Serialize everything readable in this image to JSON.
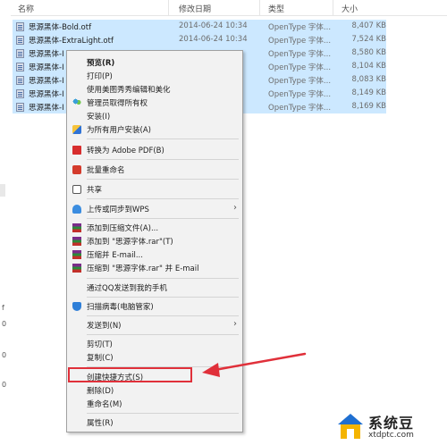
{
  "columns": {
    "name": "名称",
    "date": "修改日期",
    "type": "类型",
    "size": "大小"
  },
  "files": [
    {
      "name": "思源黑体-Bold.otf",
      "date": "2014-06-24 10:34",
      "type": "OpenType 字体...",
      "size": "8,407 KB"
    },
    {
      "name": "思源黑体-ExtraLight.otf",
      "date": "2014-06-24 10:34",
      "type": "OpenType 字体...",
      "size": "7,524 KB"
    },
    {
      "name": "思源黑体-I",
      "date": "",
      "type": "OpenType 字体...",
      "size": "8,580 KB"
    },
    {
      "name": "思源黑体-I",
      "date": "",
      "type": "OpenType 字体...",
      "size": "8,104 KB"
    },
    {
      "name": "思源黑体-I",
      "date": "",
      "type": "OpenType 字体...",
      "size": "8,083 KB"
    },
    {
      "name": "思源黑体-I",
      "date": "",
      "type": "OpenType 字体...",
      "size": "8,149 KB"
    },
    {
      "name": "思源黑体-I",
      "date": "",
      "type": "OpenType 字体...",
      "size": "8,169 KB"
    }
  ],
  "context_menu": {
    "items": [
      {
        "label": "预览(R)",
        "icon": ""
      },
      {
        "label": "打印(P)",
        "icon": ""
      },
      {
        "label": "使用美图秀秀编辑和美化",
        "icon": ""
      },
      {
        "label": "管理员取得所有权",
        "icon": "people-icon"
      },
      {
        "label": "安装(I)",
        "icon": ""
      },
      {
        "label": "为所有用户安装(A)",
        "icon": "uac-shield-icon"
      },
      {
        "label": "转换为 Adobe PDF(B)",
        "icon": "pdf-icon"
      },
      {
        "label": "批量重命名",
        "icon": "wps-icon"
      },
      {
        "label": "共享",
        "icon": "share-icon"
      },
      {
        "label": "上传或同步到WPS",
        "icon": "cloud-icon",
        "submenu": true
      },
      {
        "label": "添加到压缩文件(A)...",
        "icon": "winrar-icon"
      },
      {
        "label": "添加到 \"思源字体.rar\"(T)",
        "icon": "winrar-icon"
      },
      {
        "label": "压缩并 E-mail...",
        "icon": "winrar-icon"
      },
      {
        "label": "压缩到 \"思源字体.rar\" 并 E-mail",
        "icon": "winrar-icon"
      },
      {
        "label": "通过QQ发送到我的手机",
        "icon": ""
      },
      {
        "label": "扫描病毒(电脑管家)",
        "icon": "shield-icon"
      },
      {
        "label": "发送到(N)",
        "icon": "",
        "submenu": true
      },
      {
        "label": "剪切(T)",
        "icon": ""
      },
      {
        "label": "复制(C)",
        "icon": ""
      },
      {
        "label": "创建快捷方式(S)",
        "icon": ""
      },
      {
        "label": "删除(D)",
        "icon": ""
      },
      {
        "label": "重命名(M)",
        "icon": ""
      },
      {
        "label": "属性(R)",
        "icon": ""
      }
    ],
    "submenu_arrow": "›"
  },
  "left_strip_marks": [
    "f",
    "0",
    "0",
    "0"
  ],
  "watermark": {
    "brand": "系统豆",
    "domain": "xtdptc.com"
  },
  "colors": {
    "row_selected": "#cce8ff",
    "menu_bg": "#f2f2f2",
    "annotation_red": "#e0303a"
  }
}
